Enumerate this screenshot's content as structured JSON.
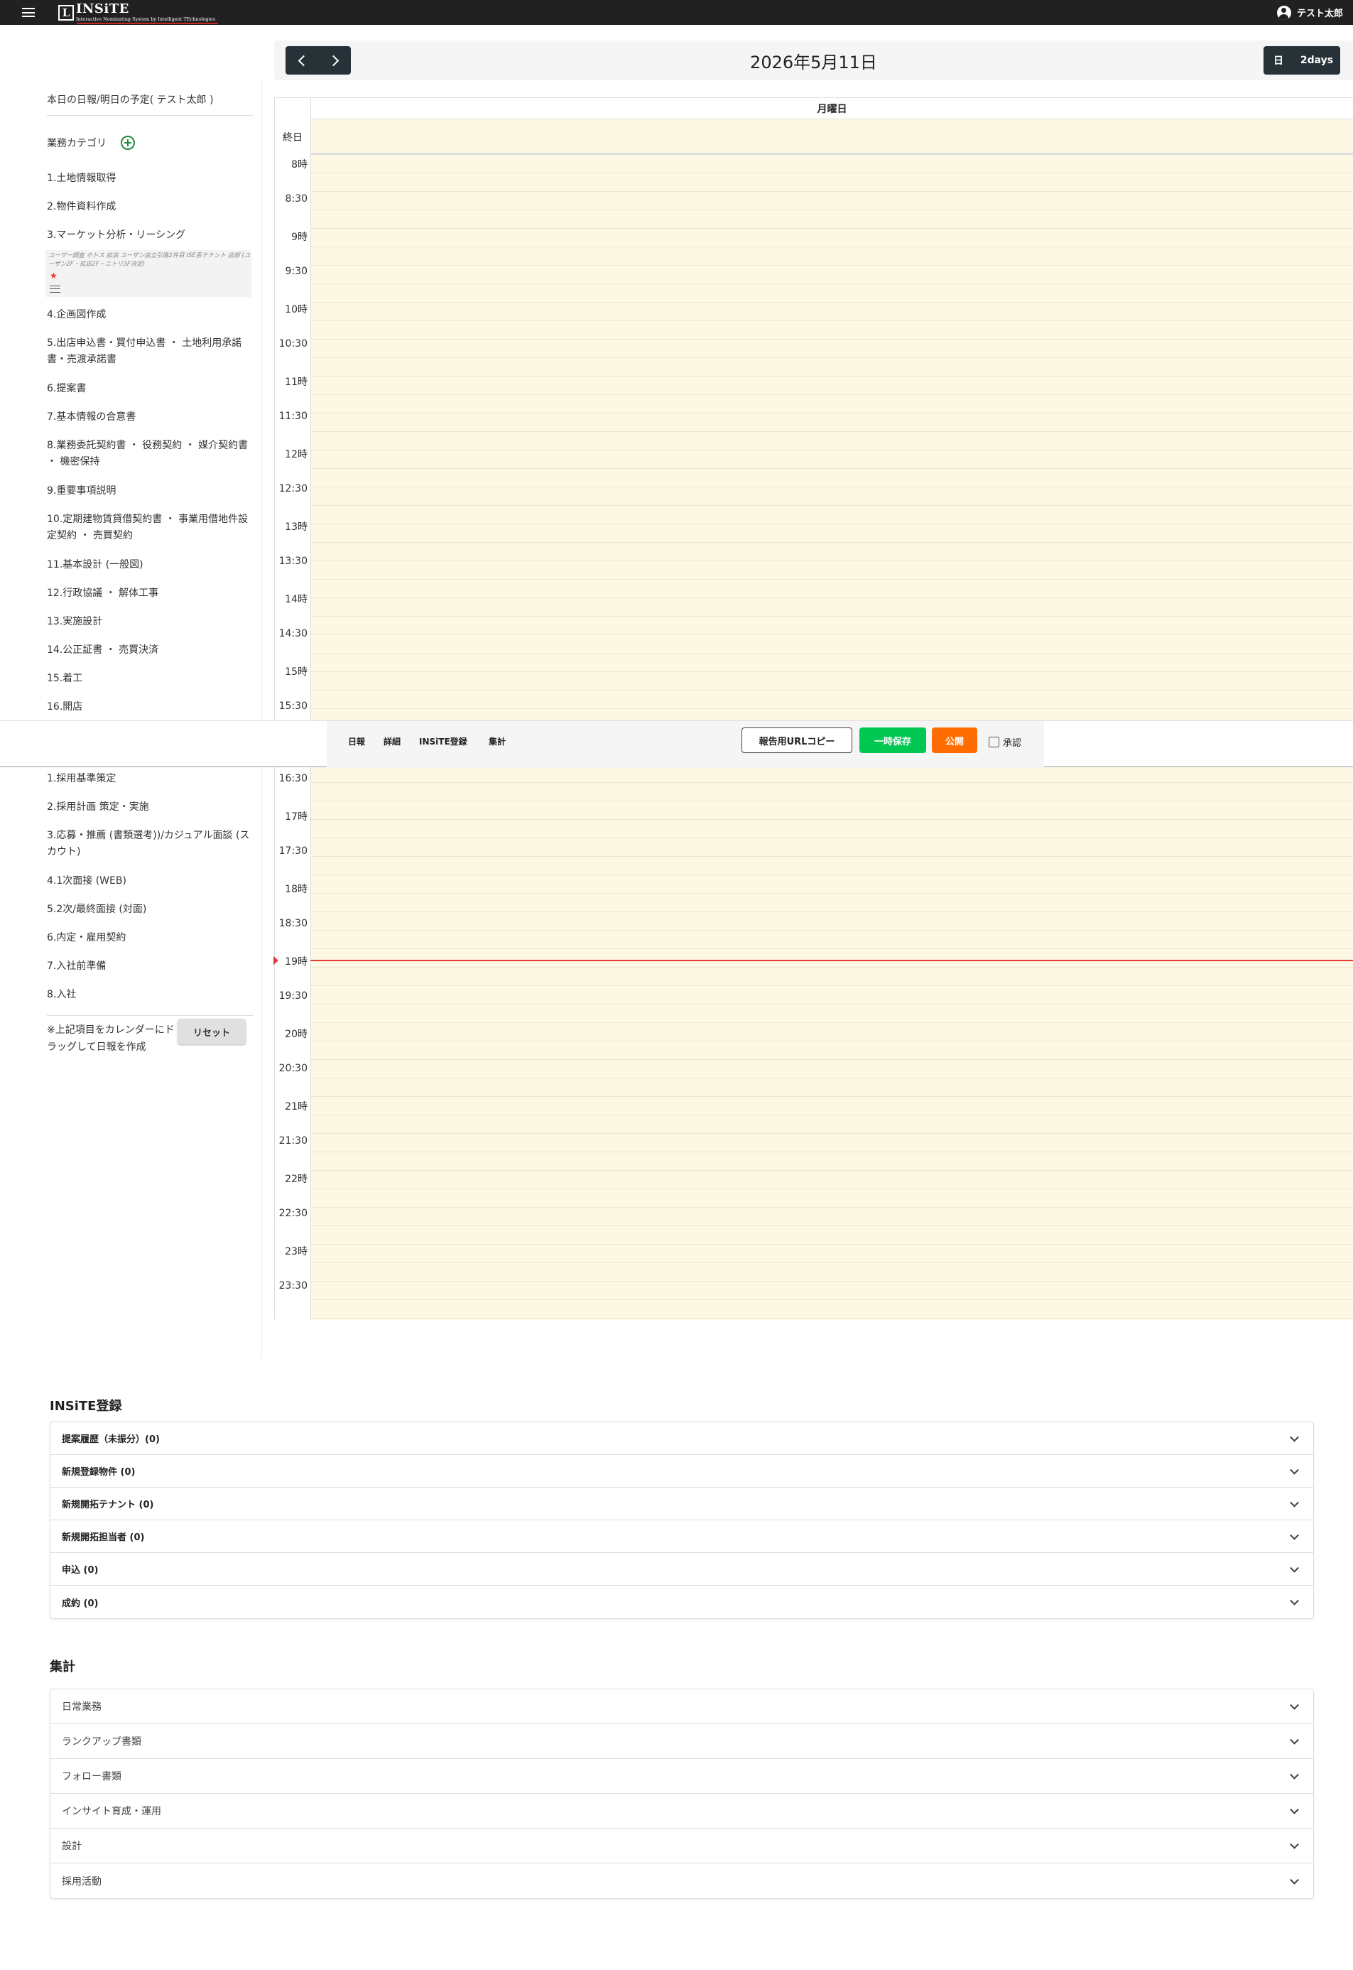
{
  "header": {
    "logo_letter": "L",
    "logo_name": "INSiTE",
    "logo_sub": "Interactive Nominating System by Intelligent TEchnologies",
    "user_name": "テスト太郎"
  },
  "sidebar": {
    "title": "本日の日報/明日の予定( テスト太郎 )",
    "category_label": "業務カテゴリ",
    "group1": [
      "1.土地情報取得",
      "2.物件資料作成",
      "3.マーケット分析・リーシング",
      "4.企画図作成",
      "5.出店申込書・買付申込書 ・ 土地利用承諾書・売渡承諾書",
      "6.提案書",
      "7.基本情報の合意書",
      "8.業務委託契約書 ・ 役務契約 ・ 媒介契約書 ・ 機密保持",
      "9.重要事項説明",
      "10.定期建物賃貸借契約書 ・ 事業用借地件設定契約 ・ 売買契約",
      "11.基本設計 (一般図)",
      "12.行政協議 ・ 解体工事",
      "13.実施設計",
      "14.公正証書 ・ 売買決済",
      "15.着工",
      "16.開店"
    ],
    "sub_note": "ユーザー調査 ホトス 拡店 ユーザン店立引進2件目 ISE系テナント 店部 (ユーザン2F・拡店2F・ニトリ3F決定)",
    "group2": [
      "1.採用基準策定",
      "2.採用計画 策定・実施",
      "3.応募・推薦 (書類選考))/カジュアル面談 (スカウト)",
      "4.1次面接 (WEB)",
      "5.2次/最終面接 (対面)",
      "6.内定・雇用契約",
      "7.入社前準備",
      "8.入社"
    ],
    "drag_note": "※上記項目をカレンダーにドラッグして日報を作成",
    "reset_label": "リセット"
  },
  "calendar": {
    "title": "2026年5月11日",
    "view_day": "日",
    "view_2days": "2days",
    "day_header": "月曜日",
    "allday_label": "終日",
    "time_labels": [
      "8時",
      "8:30",
      "9時",
      "9:30",
      "10時",
      "10:30",
      "11時",
      "11:30",
      "12時",
      "12:30",
      "13時",
      "13:30",
      "14時",
      "14:30",
      "15時",
      "15:30",
      "16:30",
      "17時",
      "17:30",
      "18時",
      "18:30",
      "19時",
      "19:30",
      "20時",
      "20:30",
      "21時",
      "21:30",
      "22時",
      "22:30",
      "23時",
      "23:30"
    ]
  },
  "toolbar": {
    "tabs": [
      "日報",
      "詳細",
      "INSiTE登録",
      "集計"
    ],
    "url_copy": "報告用URLコピー",
    "temp_save": "一時保存",
    "publish": "公開",
    "approve": "承認"
  },
  "insite": {
    "title": "INSiTE登録",
    "rows": [
      "提案履歴（未振分）(0)",
      "新規登録物件 (0)",
      "新規開拓テナント (0)",
      "新規開拓担当者 (0)",
      "申込 (0)",
      "成約 (0)"
    ]
  },
  "summary": {
    "title": "集計",
    "rows": [
      "日常業務",
      "ランクアップ書類",
      "フォロー書類",
      "インサイト育成・運用",
      "設計",
      "採用活動"
    ]
  }
}
